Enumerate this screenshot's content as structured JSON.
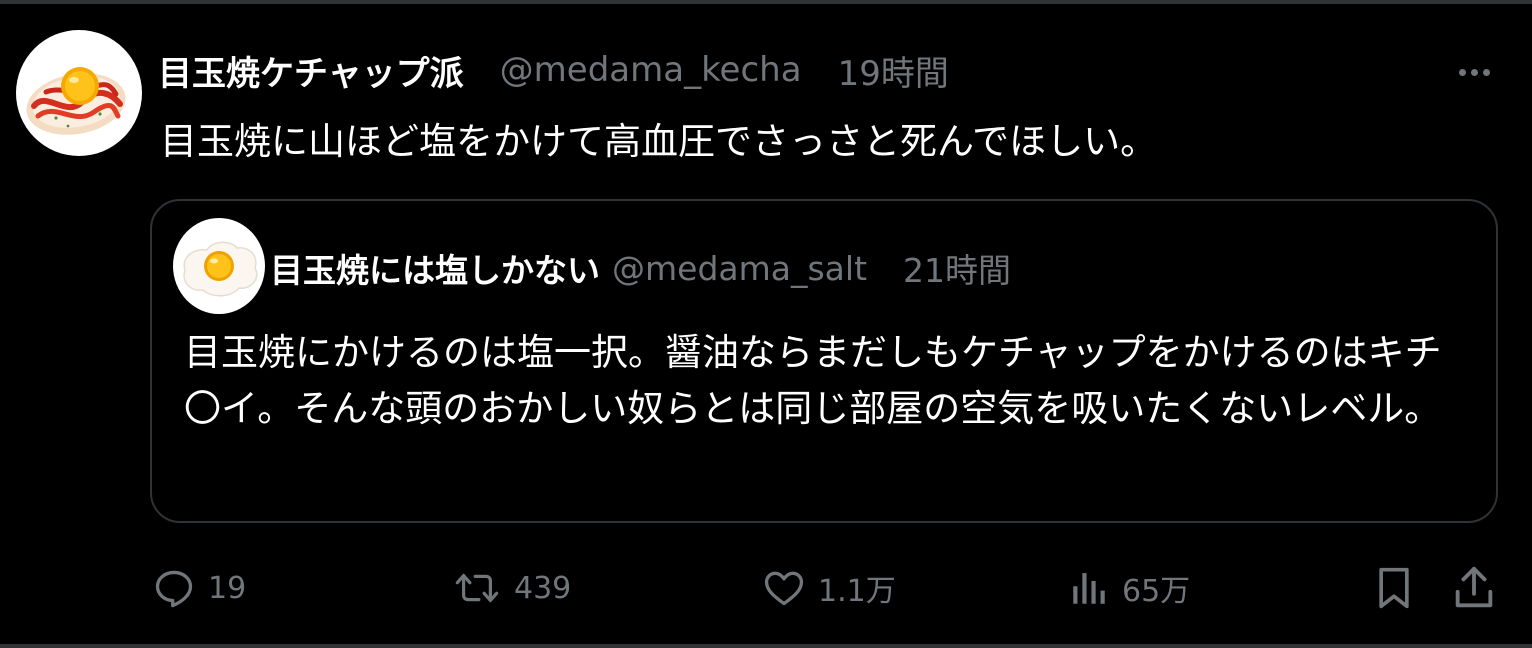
{
  "post": {
    "author": {
      "display_name": "目玉焼ケチャップ派",
      "handle": "@medama_kecha",
      "avatar_icon": "fried-egg-ketchup-avatar"
    },
    "time": "19時間",
    "text": "目玉焼に山ほど塩をかけて高血圧でさっさと死んでほしい。",
    "quoted": {
      "author": {
        "display_name": "目玉焼には塩しかない",
        "handle": "@medama_salt",
        "avatar_icon": "fried-egg-avatar"
      },
      "time": "21時間",
      "text": "目玉焼にかけるのは塩一択。醤油ならまだしもケチャップをかけるのはキチ〇イ。そんな頭のおかしい奴らとは同じ部屋の空気を吸いたくないレベル。"
    },
    "actions": {
      "replies": "19",
      "reposts": "439",
      "likes": "1.1万",
      "views": "65万"
    }
  },
  "icons": {
    "more": "more-icon",
    "reply": "reply-icon",
    "repost": "repost-icon",
    "like": "heart-icon",
    "views": "views-icon",
    "bookmark": "bookmark-icon",
    "share": "share-icon"
  },
  "colors": {
    "background": "#000000",
    "text_primary": "#ffffff",
    "text_secondary": "#71767b",
    "border": "#2f3336"
  }
}
